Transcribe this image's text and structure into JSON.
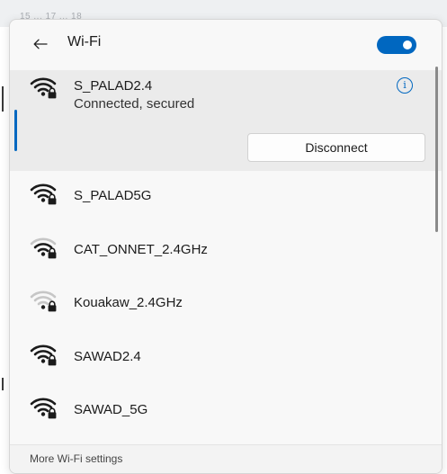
{
  "background": {
    "partial_text": "15 ... 17 ... 18"
  },
  "header": {
    "title": "Wi-Fi",
    "wifi_enabled": true,
    "accent_color": "#0067c0"
  },
  "connected_network": {
    "name": "S_PALAD2.4",
    "status": "Connected, secured",
    "info_glyph": "i",
    "signal_bars": 4,
    "secured": true,
    "disconnect_label": "Disconnect"
  },
  "networks": [
    {
      "name": "S_PALAD5G",
      "signal_bars": 4,
      "secured": true
    },
    {
      "name": "CAT_ONNET_2.4GHz",
      "signal_bars": 3,
      "secured": true
    },
    {
      "name": "Kouakaw_2.4GHz",
      "signal_bars": 1,
      "secured": true
    },
    {
      "name": "SAWAD2.4",
      "signal_bars": 4,
      "secured": true
    },
    {
      "name": "SAWAD_5G",
      "signal_bars": 4,
      "secured": true
    }
  ],
  "footer": {
    "link": "More Wi-Fi settings"
  }
}
